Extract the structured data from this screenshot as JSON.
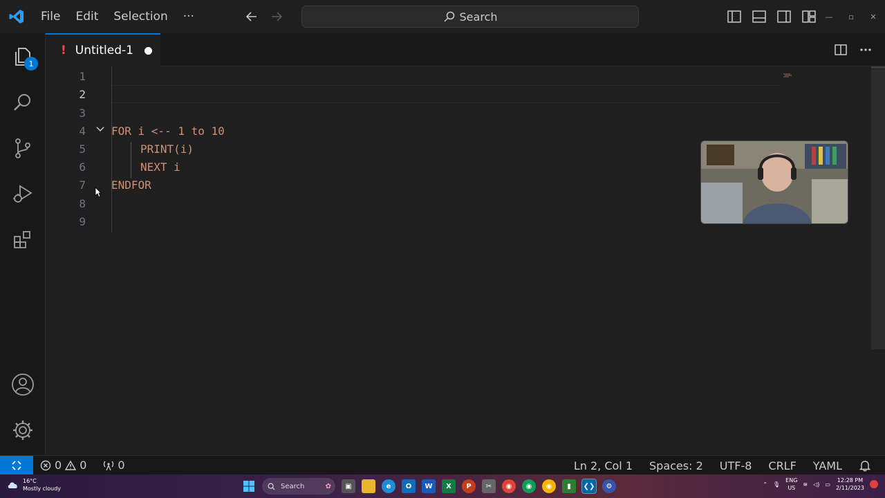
{
  "menu": {
    "file": "File",
    "edit": "Edit",
    "selection": "Selection",
    "more": "···"
  },
  "search": {
    "label": "Search"
  },
  "activity": {
    "explorer_badge": "1"
  },
  "tab": {
    "bang": "!",
    "label": "Untitled-1"
  },
  "editor": {
    "lines": [
      {
        "num": "1",
        "text": ""
      },
      {
        "num": "2",
        "text": ""
      },
      {
        "num": "3",
        "text": ""
      },
      {
        "num": "4",
        "text": "FOR i <-- 1 to 10"
      },
      {
        "num": "5",
        "text": "PRINT(i)"
      },
      {
        "num": "6",
        "text": "NEXT i"
      },
      {
        "num": "7",
        "text": "ENDFOR"
      },
      {
        "num": "8",
        "text": ""
      },
      {
        "num": "9",
        "text": ""
      }
    ],
    "code_color": "#ce9178"
  },
  "status": {
    "errors": "0",
    "warnings": "0",
    "ports": "0",
    "position": "Ln 2, Col 1",
    "spaces": "Spaces: 2",
    "encoding": "UTF-8",
    "eol": "CRLF",
    "language": "YAML"
  },
  "taskbar": {
    "temp": "16°C",
    "weather": "Mostly cloudy",
    "search": "Search",
    "lang1": "ENG",
    "lang2": "US",
    "time": "12:28 PM",
    "date": "2/11/2023"
  },
  "colors": {
    "accent": "#0078d4",
    "modified": "#f14c4c"
  }
}
